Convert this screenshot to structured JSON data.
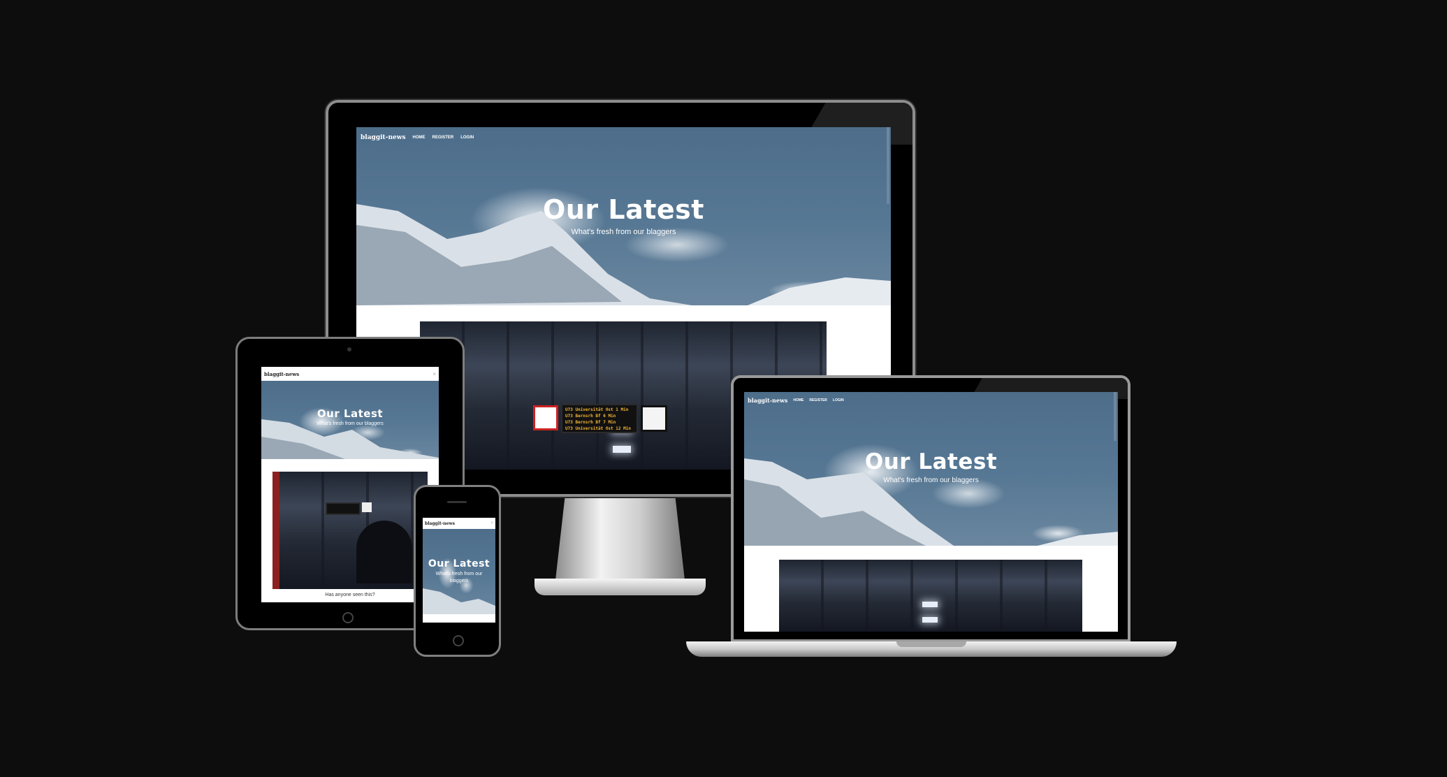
{
  "site": {
    "brand": "blaggit-news",
    "nav": [
      "HOME",
      "REGISTER",
      "LOGIN"
    ],
    "hero_title": "Our Latest",
    "hero_subtitle": "What's fresh from our blaggers"
  },
  "article": {
    "caption": "Has anyone seen this?"
  },
  "departures": [
    {
      "line": "U73",
      "dest": "Universität Ost",
      "time": "1 Min"
    },
    {
      "line": "U73",
      "dest": "Bernsrh Bf",
      "time": "6 Min"
    },
    {
      "line": "U73",
      "dest": "Bernsrh Bf",
      "time": "7 Min"
    },
    {
      "line": "U73",
      "dest": "Universität Ost",
      "time": "12 Min"
    }
  ],
  "colors": {
    "background": "#0e0d0e",
    "sky": "#577894",
    "bezel": "#050505"
  },
  "icons": [
    "close-icon",
    "home-button-icon",
    "camera-icon"
  ]
}
